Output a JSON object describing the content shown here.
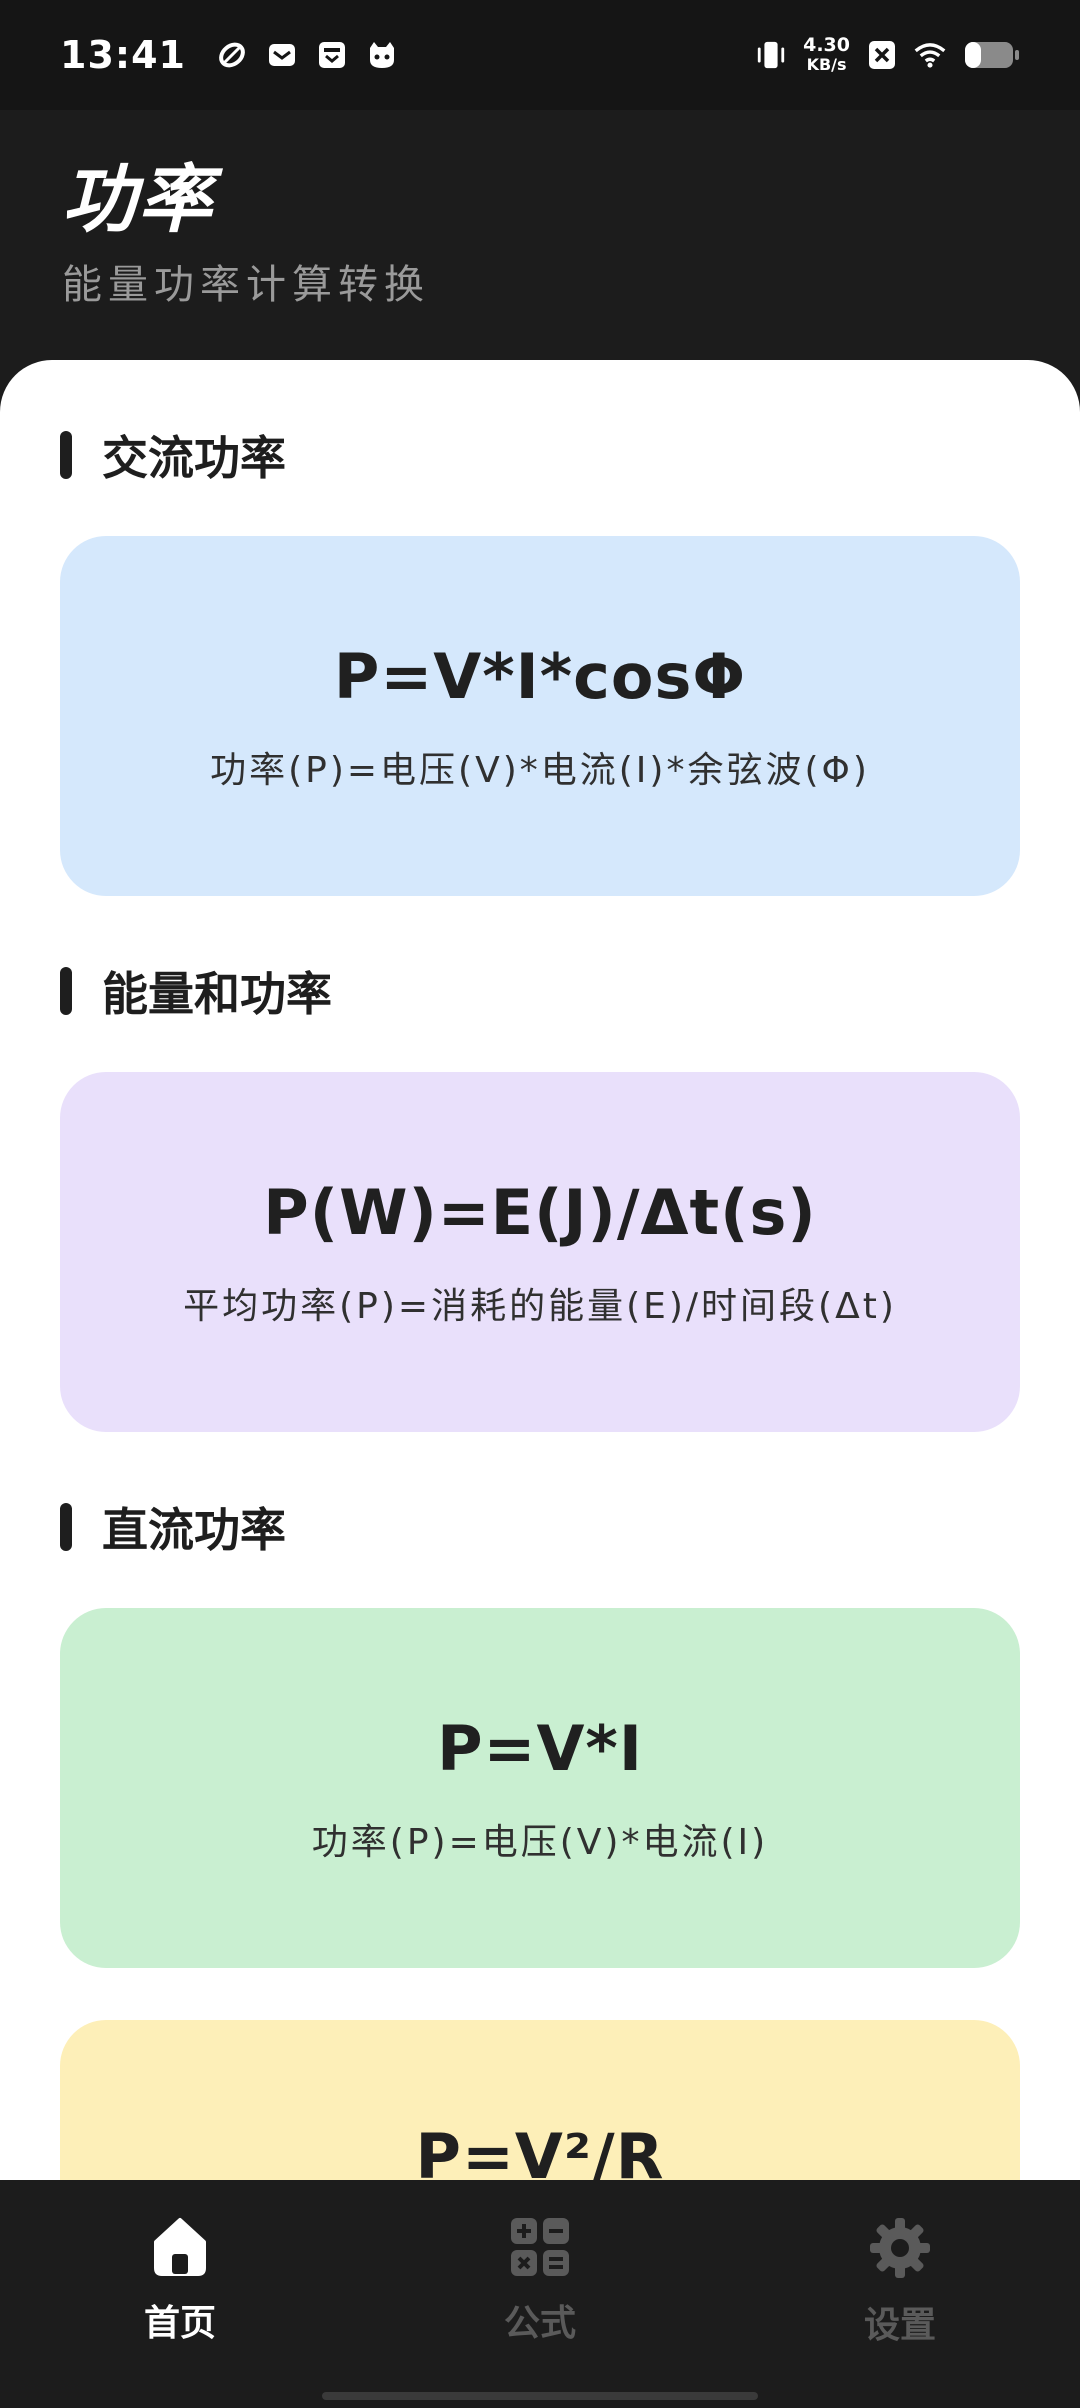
{
  "status_bar": {
    "time": "13:41",
    "net_speed_value": "4.30",
    "net_speed_unit": "KB/s",
    "icons": [
      "leaf-icon",
      "mail-icon",
      "inbox-icon",
      "cat-icon",
      "vibrate-icon",
      "close-box-icon",
      "wifi-icon",
      "battery-icon"
    ]
  },
  "header": {
    "title": "功率",
    "subtitle": "能量功率计算转换"
  },
  "sections": [
    {
      "title": "交流功率",
      "formula": "P=V*I*cosΦ",
      "description": "功率(P)=电压(V)*电流(I)*余弦波(Φ)",
      "color": "#d5e8fc"
    },
    {
      "title": "能量和功率",
      "formula": "P(W)=E(J)/Δt(s)",
      "description": "平均功率(P)=消耗的能量(E)/时间段(Δt)",
      "color": "#e9e0fb"
    },
    {
      "title": "直流功率",
      "formula": "P=V*I",
      "description": "功率(P)=电压(V)*电流(I)",
      "color": "#c9efd1"
    },
    {
      "formula": "P=V²/R",
      "color": "#fdefb8"
    }
  ],
  "nav": {
    "items": [
      {
        "label": "首页",
        "icon": "home-icon",
        "active": true
      },
      {
        "label": "公式",
        "icon": "calculator-icon",
        "active": false
      },
      {
        "label": "设置",
        "icon": "gear-icon",
        "active": false
      }
    ]
  }
}
